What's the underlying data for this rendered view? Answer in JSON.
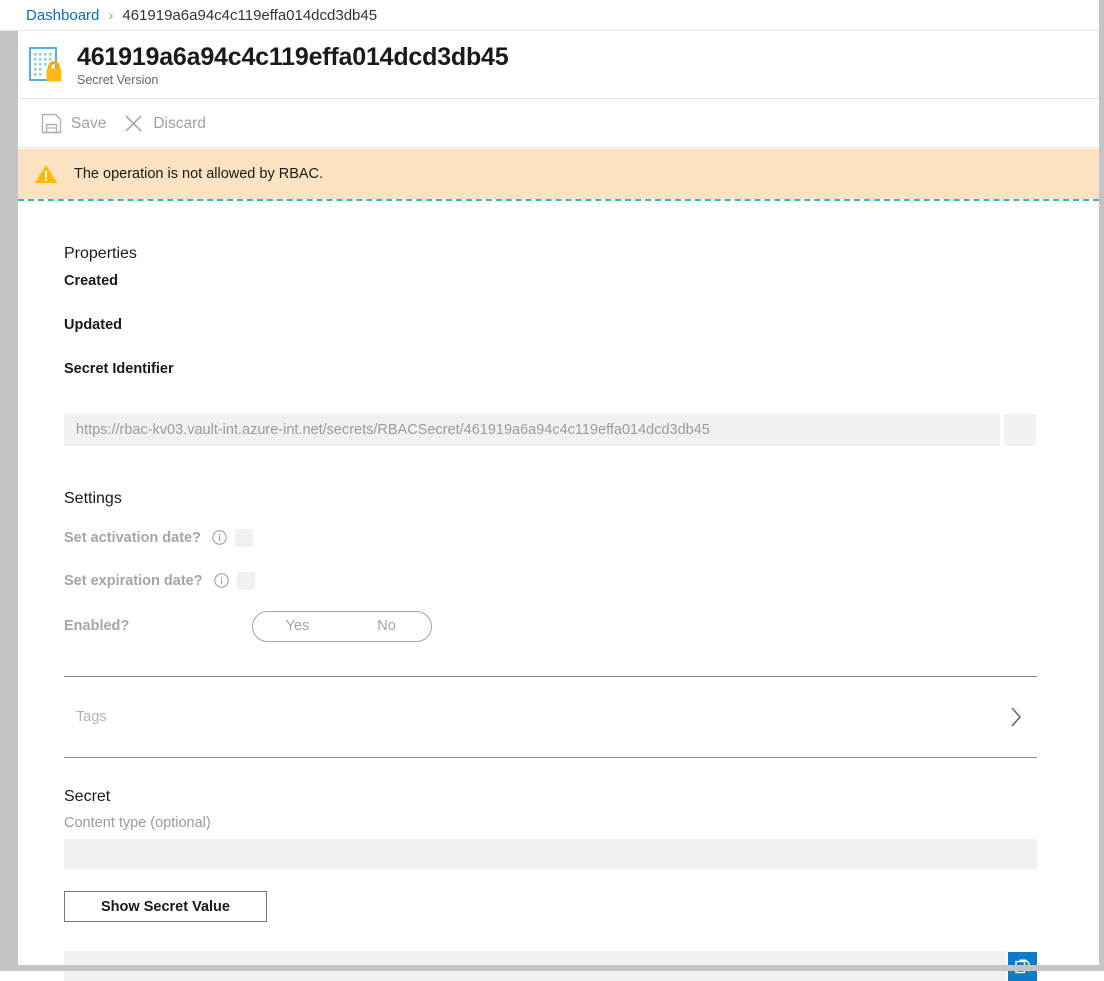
{
  "breadcrumb": {
    "root": "Dashboard",
    "separator": "›",
    "current": "461919a6a94c4c119effa014dcd3db45"
  },
  "header": {
    "title": "461919a6a94c4c119effa014dcd3db45",
    "subtitle": "Secret Version",
    "icon": "key-vault-secret-icon"
  },
  "toolbar": {
    "save_label": "Save",
    "save_icon": "save-disk-icon",
    "discard_label": "Discard",
    "discard_icon": "close-x-icon"
  },
  "notification": {
    "icon": "warning-triangle-icon",
    "message": "The operation is not allowed by RBAC.",
    "background": "#fbe2c0",
    "icon_color": "#ffb900",
    "divider_color": "#29b6d8"
  },
  "properties": {
    "heading": "Properties",
    "created_label": "Created",
    "created_value": "",
    "updated_label": "Updated",
    "updated_value": "",
    "secret_identifier_label": "Secret Identifier",
    "secret_identifier_value": "https://rbac-kv03.vault-int.azure-int.net/secrets/RBACSecret/461919a6a94c4c119effa014dcd3db45",
    "secret_identifier_copy_icon": "copy-icon"
  },
  "settings": {
    "heading": "Settings",
    "activation_label": "Set activation date?",
    "activation_info_icon": "info-circle-icon",
    "expiration_label": "Set expiration date?",
    "expiration_info_icon": "info-circle-icon",
    "enabled_label": "Enabled?",
    "enabled_yes": "Yes",
    "enabled_no": "No"
  },
  "tags": {
    "label": "Tags",
    "chevron_icon": "chevron-right-icon"
  },
  "secret": {
    "heading": "Secret",
    "content_type_label": "Content type (optional)",
    "content_type_value": "",
    "show_button_label": "Show Secret Value",
    "secret_value": "",
    "copy_icon": "copy-icon",
    "copy_button_color": "#0f7ac8"
  }
}
